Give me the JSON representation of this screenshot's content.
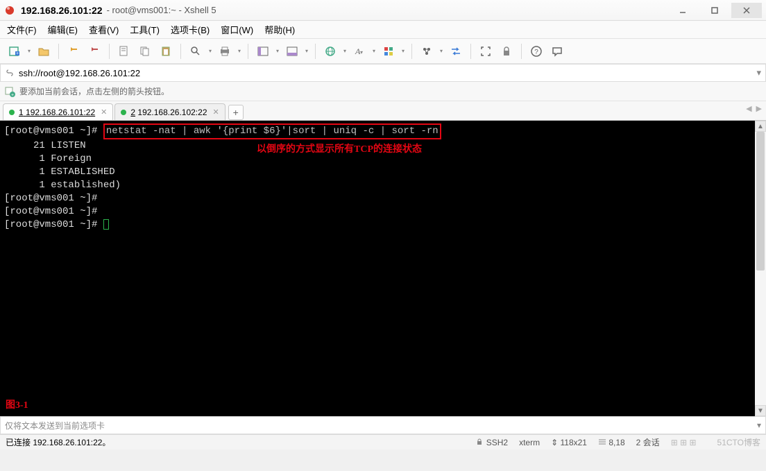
{
  "title": {
    "bold": "192.168.26.101:22",
    "rest": "root@vms001:~ - Xshell 5"
  },
  "menu": [
    "文件(F)",
    "编辑(E)",
    "查看(V)",
    "工具(T)",
    "选项卡(B)",
    "窗口(W)",
    "帮助(H)"
  ],
  "address": "ssh://root@192.168.26.101:22",
  "hint": "要添加当前会话，点击左侧的箭头按钮。",
  "tabs": [
    {
      "num": "1",
      "label": "192.168.26.101:22",
      "active": true
    },
    {
      "num": "2",
      "label": "192.168.26.102:22",
      "active": false
    }
  ],
  "terminal": {
    "prompt": "[root@vms001 ~]#",
    "command": "netstat -nat | awk '{print $6}'|sort | uniq -c | sort -rn",
    "output": [
      "     21 LISTEN",
      "      1 Foreign",
      "      1 ESTABLISHED",
      "      1 established)"
    ],
    "empty_prompts": 3,
    "annotation": "以倒序的方式显示所有TCP的连接状态",
    "figure": "图3-1"
  },
  "sendbar_placeholder": "仅将文本发送到当前选项卡",
  "status": {
    "left": "已连接 192.168.26.101:22。",
    "ssh": "SSH2",
    "term": "xterm",
    "size": "118x21",
    "cursor": "8,18",
    "sessions": "2 会话",
    "watermark": "51CTO博客"
  }
}
